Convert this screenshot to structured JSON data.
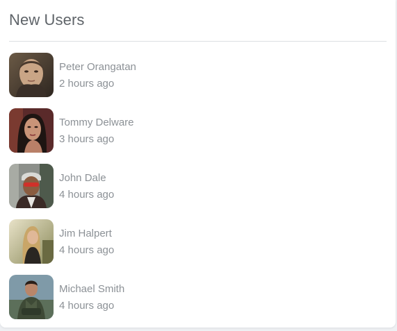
{
  "widget": {
    "title": "New Users"
  },
  "users": [
    {
      "name": "Peter Orangatan",
      "time": "2 hours ago",
      "avatar_icon": "user-photo"
    },
    {
      "name": "Tommy Delware",
      "time": "3 hours ago",
      "avatar_icon": "user-photo"
    },
    {
      "name": "John Dale",
      "time": "4 hours ago",
      "avatar_icon": "user-photo"
    },
    {
      "name": "Jim Halpert",
      "time": "4 hours ago",
      "avatar_icon": "user-photo"
    },
    {
      "name": "Michael Smith",
      "time": "4 hours ago",
      "avatar_icon": "user-photo"
    }
  ]
}
